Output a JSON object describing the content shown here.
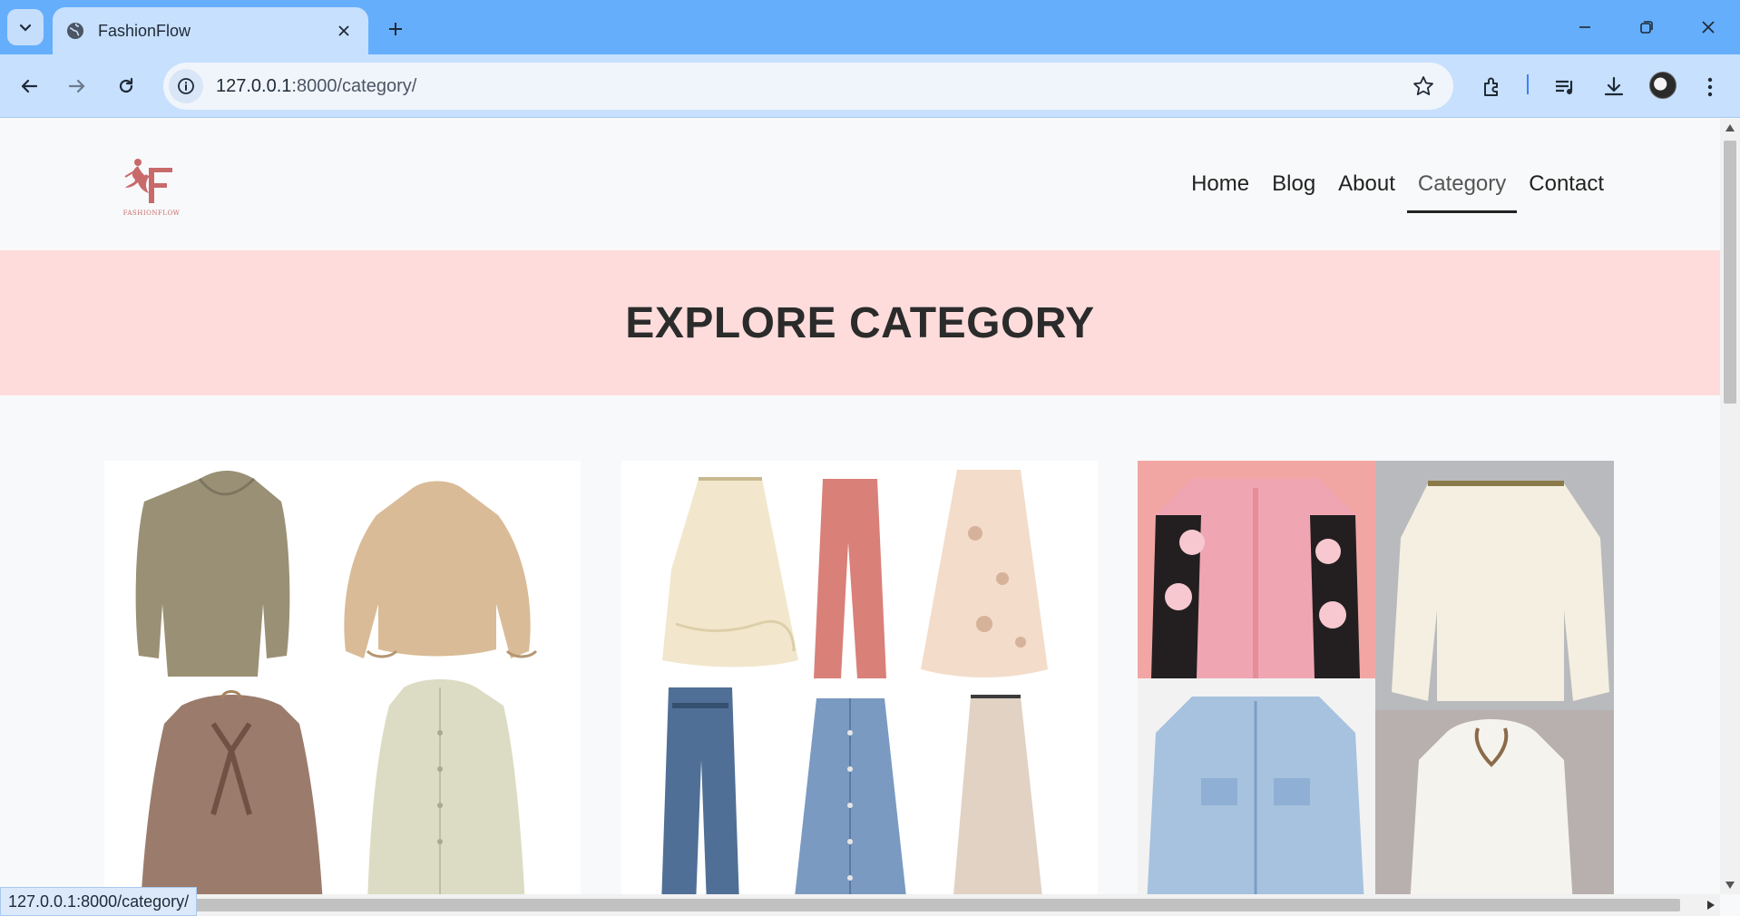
{
  "browser": {
    "tab_title": "FashionFlow",
    "url_host": "127.0.0.1",
    "url_path": ":8000/category/",
    "status_url": "127.0.0.1:8000/category/"
  },
  "site": {
    "logo_text": "FASHIONFLOW",
    "nav": [
      {
        "label": "Home",
        "active": false
      },
      {
        "label": "Blog",
        "active": false
      },
      {
        "label": "About",
        "active": false
      },
      {
        "label": "Category",
        "active": true
      },
      {
        "label": "Contact",
        "active": false
      }
    ],
    "banner_title": "EXPLORE CATEGORY"
  },
  "categories": [
    {
      "items": [
        "taupe-drape-neck-blouse",
        "champagne-satin-blouse",
        "plaid-bow-blouse",
        "sage-button-shirt"
      ]
    },
    {
      "items": [
        "cream-ruffle-skirt",
        "rose-wide-trousers",
        "floral-tulle-skirt",
        "high-waist-jeans",
        "denim-button-skirt",
        "beige-maxi-skirt"
      ]
    },
    {
      "items": [
        "floral-knit-cardigan",
        "cream-crochet-top",
        "cropped-denim-jacket",
        "white-knit-bolero"
      ]
    }
  ],
  "colors": {
    "tabstrip": "#65aefb",
    "toolbar": "#c7e0fd",
    "banner": "#ffdcdc",
    "logo": "#c96a6a"
  }
}
